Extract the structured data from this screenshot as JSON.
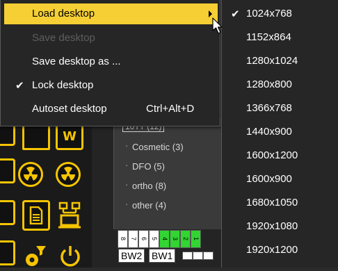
{
  "menu": {
    "items": [
      {
        "label": "Load desktop",
        "state": "highlighted",
        "has_submenu": true
      },
      {
        "label": "Save desktop",
        "state": "disabled"
      },
      {
        "label": "Save desktop as ...",
        "state": "normal"
      },
      {
        "label": "Lock desktop",
        "state": "checked",
        "checkmark": "✔"
      },
      {
        "label": "Autoset desktop",
        "state": "normal",
        "shortcut": "Ctrl+Alt+D"
      }
    ]
  },
  "submenu": {
    "checkmark": "✔",
    "selected": "1024x768",
    "items": [
      {
        "label": "1024x768"
      },
      {
        "label": "1152x864"
      },
      {
        "label": "1280x1024"
      },
      {
        "label": "1280x800"
      },
      {
        "label": "1366x768"
      },
      {
        "label": "1440x900"
      },
      {
        "label": "1600x1200"
      },
      {
        "label": "1600x900"
      },
      {
        "label": "1680x1050"
      },
      {
        "label": "1920x1080"
      },
      {
        "label": "1920x1200"
      }
    ]
  },
  "tree": {
    "header": "10TT (12)",
    "items": [
      {
        "label": "Cosmetic (3)"
      },
      {
        "label": "DFO (5)"
      },
      {
        "label": "ortho (8)"
      },
      {
        "label": "other (4)"
      }
    ]
  },
  "layout_grid": {
    "cells": [
      "8",
      "7",
      "6",
      "5",
      "4",
      "3",
      "2",
      "1"
    ],
    "green_cells": [
      "4",
      "3",
      "2",
      "1"
    ],
    "buttons": [
      "BW2",
      "BW1"
    ]
  },
  "colors": {
    "highlight": "#f5cf34",
    "menu_bg": "#262626",
    "toolbar_accent": "#f6c500",
    "grid_green": "#32d532"
  }
}
